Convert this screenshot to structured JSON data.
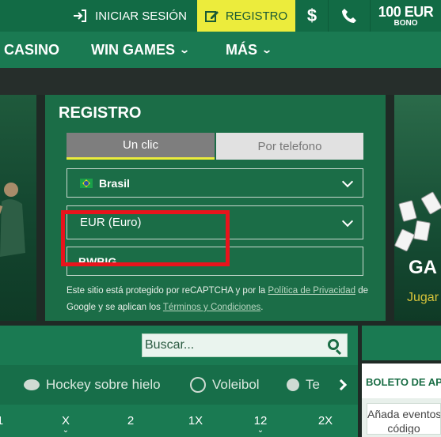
{
  "topbar": {
    "login_label": "INICIAR SESIÓN",
    "register_label": "REGISTRO",
    "dollar_label": "$",
    "bonus_amount": "100 EUR",
    "bonus_label": "BONO"
  },
  "nav": {
    "items": [
      {
        "label": "CASINO"
      },
      {
        "label": "WIN GAMES"
      },
      {
        "label": "MÁS"
      }
    ]
  },
  "banner": {
    "right_title": "GA",
    "right_subtitle": "Jugar"
  },
  "registration": {
    "title": "REGISTRO",
    "tabs": [
      {
        "label": "Un clic",
        "active": true
      },
      {
        "label": "Por telefono",
        "active": false
      }
    ],
    "country": "Brasil",
    "currency": "EUR (Euro)",
    "promo_code": "BWBIG",
    "legal": {
      "prefix": "Este sitio está protegido por reCAPTCHA y por la",
      "privacy_link": "Política de Privacidad",
      "middle": "de Google y se aplican los",
      "terms_link": "Términos y Condiciones",
      "suffix": "."
    }
  },
  "search": {
    "placeholder": "Buscar..."
  },
  "sports": [
    {
      "label": "Hockey sobre hielo"
    },
    {
      "label": "Voleibol"
    },
    {
      "label": "Te"
    }
  ],
  "odds_headers": [
    "1",
    "X",
    "2",
    "1X",
    "12",
    "2X"
  ],
  "betslip": {
    "title": "BOLETO DE APUESTAS",
    "body_text_line1": "Añada eventos",
    "body_text_line2": "código"
  },
  "colors": {
    "topbar": "#126b45",
    "nav": "#1a7a52",
    "register_accent": "#ecec3c",
    "highlight_border": "#e8141c"
  }
}
